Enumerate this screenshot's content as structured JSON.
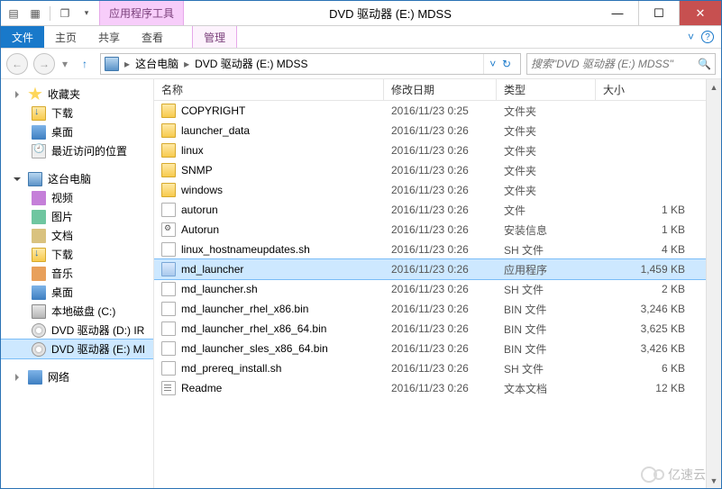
{
  "title_bar": {
    "contextual_label": "应用程序工具",
    "window_title": "DVD 驱动器 (E:) MDSS"
  },
  "ribbon": {
    "file": "文件",
    "tabs": [
      "主页",
      "共享",
      "查看"
    ],
    "context_tab": "管理"
  },
  "breadcrumb": {
    "root": "这台电脑",
    "current": "DVD 驱动器 (E:) MDSS"
  },
  "search": {
    "placeholder": "搜索\"DVD 驱动器 (E:) MDSS\""
  },
  "sidebar": {
    "favorites": {
      "label": "收藏夹",
      "items": [
        {
          "icon": "dl",
          "label": "下载"
        },
        {
          "icon": "desktop",
          "label": "桌面"
        },
        {
          "icon": "recent",
          "label": "最近访问的位置"
        }
      ]
    },
    "this_pc": {
      "label": "这台电脑",
      "items": [
        {
          "icon": "vid",
          "label": "视频"
        },
        {
          "icon": "pic",
          "label": "图片"
        },
        {
          "icon": "doc",
          "label": "文档"
        },
        {
          "icon": "dl",
          "label": "下载"
        },
        {
          "icon": "music",
          "label": "音乐"
        },
        {
          "icon": "desktop",
          "label": "桌面"
        },
        {
          "icon": "hdd",
          "label": "本地磁盘 (C:)"
        },
        {
          "icon": "dvd",
          "label": "DVD 驱动器 (D:) IR"
        },
        {
          "icon": "dvd",
          "label": "DVD 驱动器 (E:) MI",
          "selected": true
        }
      ]
    },
    "network": {
      "label": "网络"
    }
  },
  "columns": {
    "name": "名称",
    "date": "修改日期",
    "type": "类型",
    "size": "大小"
  },
  "files": [
    {
      "icon": "folder",
      "name": "COPYRIGHT",
      "date": "2016/11/23 0:25",
      "type": "文件夹",
      "size": ""
    },
    {
      "icon": "folder",
      "name": "launcher_data",
      "date": "2016/11/23 0:26",
      "type": "文件夹",
      "size": ""
    },
    {
      "icon": "folder",
      "name": "linux",
      "date": "2016/11/23 0:26",
      "type": "文件夹",
      "size": ""
    },
    {
      "icon": "folder",
      "name": "SNMP",
      "date": "2016/11/23 0:26",
      "type": "文件夹",
      "size": ""
    },
    {
      "icon": "folder",
      "name": "windows",
      "date": "2016/11/23 0:26",
      "type": "文件夹",
      "size": ""
    },
    {
      "icon": "file",
      "name": "autorun",
      "date": "2016/11/23 0:26",
      "type": "文件",
      "size": "1 KB"
    },
    {
      "icon": "ini",
      "name": "Autorun",
      "date": "2016/11/23 0:26",
      "type": "安装信息",
      "size": "1 KB"
    },
    {
      "icon": "sh",
      "name": "linux_hostnameupdates.sh",
      "date": "2016/11/23 0:26",
      "type": "SH 文件",
      "size": "4 KB"
    },
    {
      "icon": "exe",
      "name": "md_launcher",
      "date": "2016/11/23 0:26",
      "type": "应用程序",
      "size": "1,459 KB",
      "selected": true
    },
    {
      "icon": "sh",
      "name": "md_launcher.sh",
      "date": "2016/11/23 0:26",
      "type": "SH 文件",
      "size": "2 KB"
    },
    {
      "icon": "file",
      "name": "md_launcher_rhel_x86.bin",
      "date": "2016/11/23 0:26",
      "type": "BIN 文件",
      "size": "3,246 KB"
    },
    {
      "icon": "file",
      "name": "md_launcher_rhel_x86_64.bin",
      "date": "2016/11/23 0:26",
      "type": "BIN 文件",
      "size": "3,625 KB"
    },
    {
      "icon": "file",
      "name": "md_launcher_sles_x86_64.bin",
      "date": "2016/11/23 0:26",
      "type": "BIN 文件",
      "size": "3,426 KB"
    },
    {
      "icon": "sh",
      "name": "md_prereq_install.sh",
      "date": "2016/11/23 0:26",
      "type": "SH 文件",
      "size": "6 KB"
    },
    {
      "icon": "txt",
      "name": "Readme",
      "date": "2016/11/23 0:26",
      "type": "文本文档",
      "size": "12 KB"
    }
  ],
  "watermark": "亿速云"
}
